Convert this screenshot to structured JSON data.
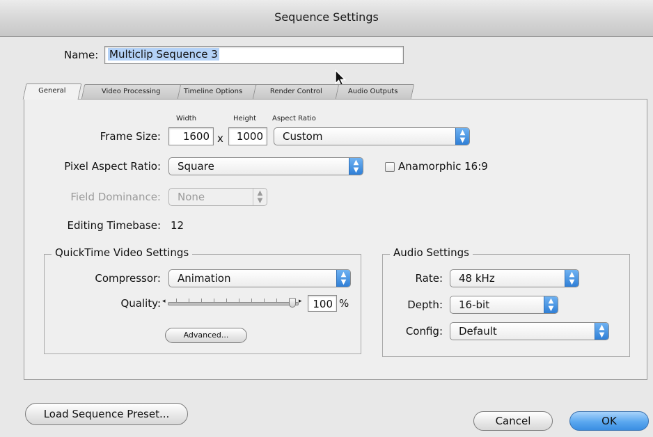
{
  "window": {
    "title": "Sequence Settings"
  },
  "name": {
    "label": "Name:",
    "value": "Multiclip Sequence 3"
  },
  "tabs": [
    {
      "label": "General",
      "active": true
    },
    {
      "label": "Video Processing",
      "active": false
    },
    {
      "label": "Timeline Options",
      "active": false
    },
    {
      "label": "Render Control",
      "active": false
    },
    {
      "label": "Audio Outputs",
      "active": false
    }
  ],
  "general": {
    "frame_size": {
      "label": "Frame Size:",
      "width_header": "Width",
      "height_header": "Height",
      "aspect_header": "Aspect Ratio",
      "width": "1600",
      "times": "x",
      "height": "1000",
      "aspect_ratio": "Custom"
    },
    "pixel_aspect": {
      "label": "Pixel Aspect Ratio:",
      "value": "Square",
      "anamorphic_label": "Anamorphic 16:9",
      "anamorphic_checked": false
    },
    "field_dominance": {
      "label": "Field Dominance:",
      "value": "None",
      "disabled": true
    },
    "editing_timebase": {
      "label": "Editing Timebase:",
      "value": "12"
    },
    "quicktime": {
      "title": "QuickTime Video Settings",
      "compressor_label": "Compressor:",
      "compressor_value": "Animation",
      "quality_label": "Quality:",
      "quality_value": "100",
      "quality_unit": "%",
      "quality_fraction": 1.0,
      "advanced_label": "Advanced..."
    },
    "audio": {
      "title": "Audio Settings",
      "rate_label": "Rate:",
      "rate_value": "48 kHz",
      "depth_label": "Depth:",
      "depth_value": "16-bit",
      "config_label": "Config:",
      "config_value": "Default"
    }
  },
  "buttons": {
    "load_preset": "Load Sequence Preset...",
    "cancel": "Cancel",
    "ok": "OK"
  },
  "colors": {
    "accent": "#3a8ee2",
    "selection": "#b4d2f7"
  }
}
